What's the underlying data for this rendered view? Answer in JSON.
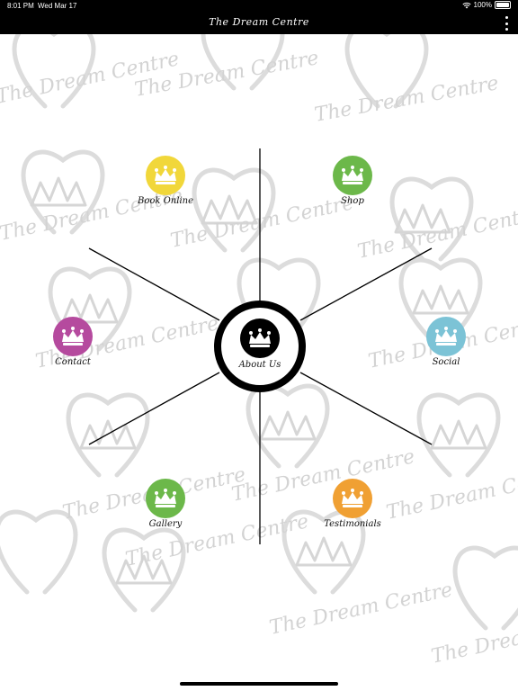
{
  "status_bar": {
    "time": "8:01 PM",
    "date": "Wed Mar 17",
    "battery": "100%",
    "wifi_icon": "wifi-icon",
    "battery_icon": "battery-icon"
  },
  "nav": {
    "title": "The Dream Centre",
    "menu_icon": "more-vertical-icon"
  },
  "watermark_text": "The Dream Centre",
  "colors": {
    "yellow": "#f1d73a",
    "green": "#6cb84a",
    "purple": "#b54a9e",
    "blue": "#7cc3d6",
    "orange": "#f0a033",
    "black": "#000000"
  },
  "menu": {
    "book_online": "Book Online",
    "shop": "Shop",
    "contact": "Contact",
    "about_us": "About Us",
    "social": "Social",
    "gallery": "Gallery",
    "testimonials": "Testimonials",
    "icon": "crown-icon"
  }
}
